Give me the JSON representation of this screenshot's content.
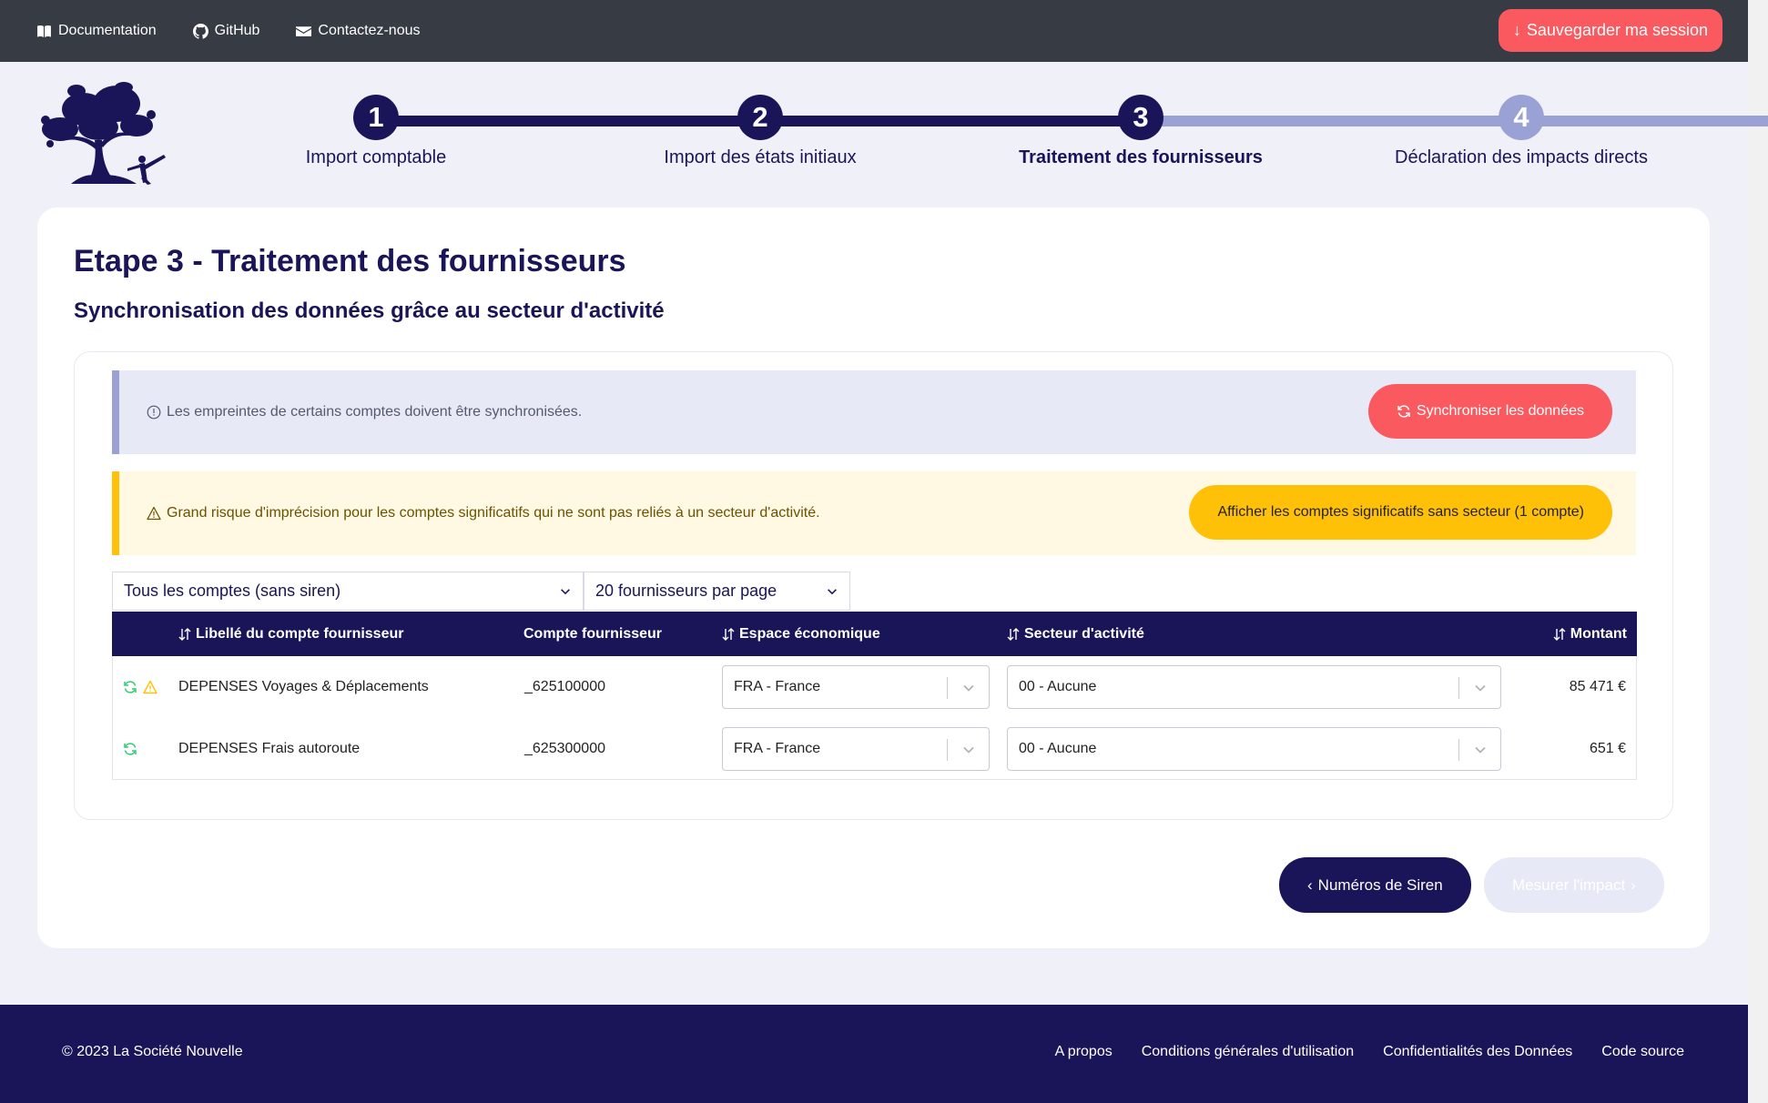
{
  "topbar": {
    "links": [
      "Documentation",
      "GitHub",
      "Contactez-nous"
    ],
    "save_label": "Sauvegarder ma session"
  },
  "colors": {
    "primary": "#191558",
    "accent": "#fa595f",
    "warning": "#ffc107",
    "step_inactive": "#9aa1d5"
  },
  "stepper": {
    "current": 3,
    "steps": [
      {
        "number": "1",
        "label": "Import comptable"
      },
      {
        "number": "2",
        "label": "Import des états initiaux"
      },
      {
        "number": "3",
        "label": "Traitement des fournisseurs"
      },
      {
        "number": "4",
        "label": "Déclaration des impacts directs"
      }
    ]
  },
  "page": {
    "title": "Etape 3 - Traitement des fournisseurs",
    "subtitle": "Synchronisation des données grâce au secteur d'activité"
  },
  "alerts": {
    "info_text": "Les empreintes de certains comptes doivent être synchronisées.",
    "sync_label": "Synchroniser les données",
    "warning_text": "Grand risque d'imprécision pour les comptes significatifs qui ne sont pas reliés à un secteur d'activité.",
    "show_label": "Afficher les comptes significatifs sans secteur (1 compte)"
  },
  "filters": {
    "accounts": "Tous les comptes (sans siren)",
    "per_page": "20 fournisseurs par page"
  },
  "table": {
    "headers": {
      "label": "Libellé du compte fournisseur",
      "account": "Compte fournisseur",
      "space": "Espace économique",
      "sector": "Secteur d'activité",
      "amount": "Montant"
    },
    "rows": [
      {
        "label": "DEPENSES Voyages & Déplacements",
        "account": "_625100000",
        "space": "FRA - France",
        "sector": "00 - Aucune",
        "amount": "85 471 €",
        "warning": true
      },
      {
        "label": "DEPENSES Frais autoroute",
        "account": "_625300000",
        "space": "FRA - France",
        "sector": "00 - Aucune",
        "amount": "651 €",
        "warning": false
      }
    ]
  },
  "nav": {
    "prev_label": "Numéros de Siren",
    "next_label": "Mesurer l'impact"
  },
  "footer": {
    "copyright": "© 2023 La Société Nouvelle",
    "links": [
      "A propos",
      "Conditions générales d'utilisation",
      "Confidentialités des Données",
      "Code source"
    ]
  }
}
